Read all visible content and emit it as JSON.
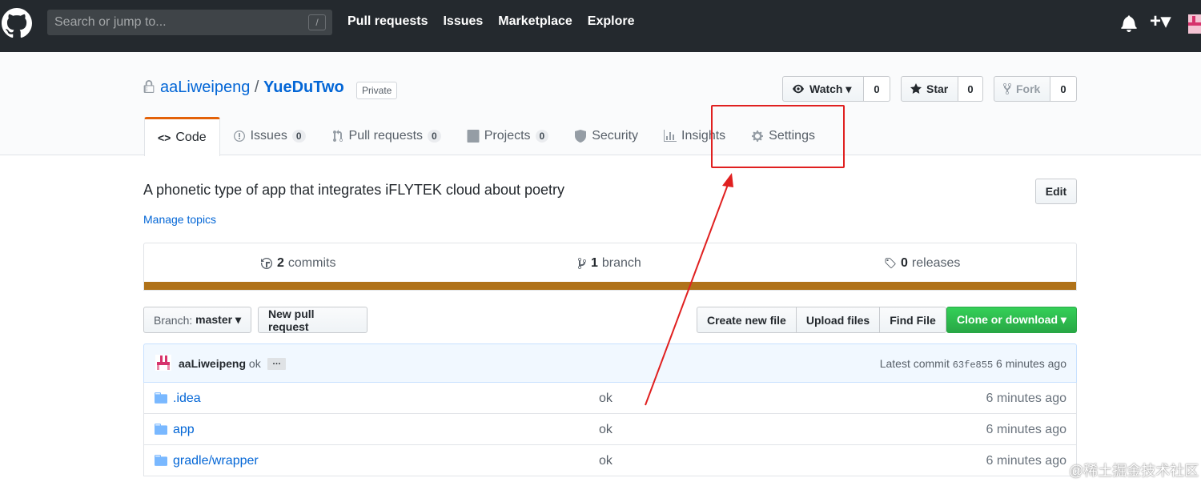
{
  "header": {
    "search_placeholder": "Search or jump to...",
    "slash_key": "/",
    "nav": [
      "Pull requests",
      "Issues",
      "Marketplace",
      "Explore"
    ],
    "plus": "+▾"
  },
  "repo": {
    "owner": "aaLiweipeng",
    "separator": "/",
    "name": "YueDuTwo",
    "visibility": "Private",
    "watch_label": "Watch ▾",
    "watch_count": "0",
    "star_label": "Star",
    "star_count": "0",
    "fork_label": "Fork",
    "fork_count": "0"
  },
  "tabs": {
    "code": "Code",
    "issues": "Issues",
    "issues_count": "0",
    "pulls": "Pull requests",
    "pulls_count": "0",
    "projects": "Projects",
    "projects_count": "0",
    "security": "Security",
    "insights": "Insights",
    "settings": "Settings"
  },
  "about": {
    "description": "A phonetic type of app that integrates iFLYTEK cloud about poetry",
    "manage_topics": "Manage topics",
    "edit": "Edit"
  },
  "summary": {
    "commits_num": "2",
    "commits_label": "commits",
    "branch_num": "1",
    "branch_label": "branch",
    "releases_num": "0",
    "releases_label": "releases",
    "language_color": "#b07219"
  },
  "filenav": {
    "branch_prefix": "Branch:",
    "branch_name": "master ▾",
    "new_pr": "New pull request",
    "create_file": "Create new file",
    "upload": "Upload files",
    "find": "Find File",
    "clone": "Clone or download ▾"
  },
  "commit": {
    "author": "aaLiweipeng",
    "message": "ok",
    "ellipsis": "…",
    "latest_label": "Latest commit",
    "sha": "63fe855",
    "age": "6 minutes ago"
  },
  "files": [
    {
      "name": ".idea",
      "msg": "ok",
      "age": "6 minutes ago"
    },
    {
      "name": "app",
      "msg": "ok",
      "age": "6 minutes ago"
    },
    {
      "name": "gradle/wrapper",
      "msg": "ok",
      "age": "6 minutes ago"
    }
  ],
  "watermark": "@稀土掘金技术社区",
  "colors": {
    "accent_tab": "#e36209",
    "link": "#0366d6",
    "annotation": "#e02020",
    "clone_green": "#28a745"
  }
}
